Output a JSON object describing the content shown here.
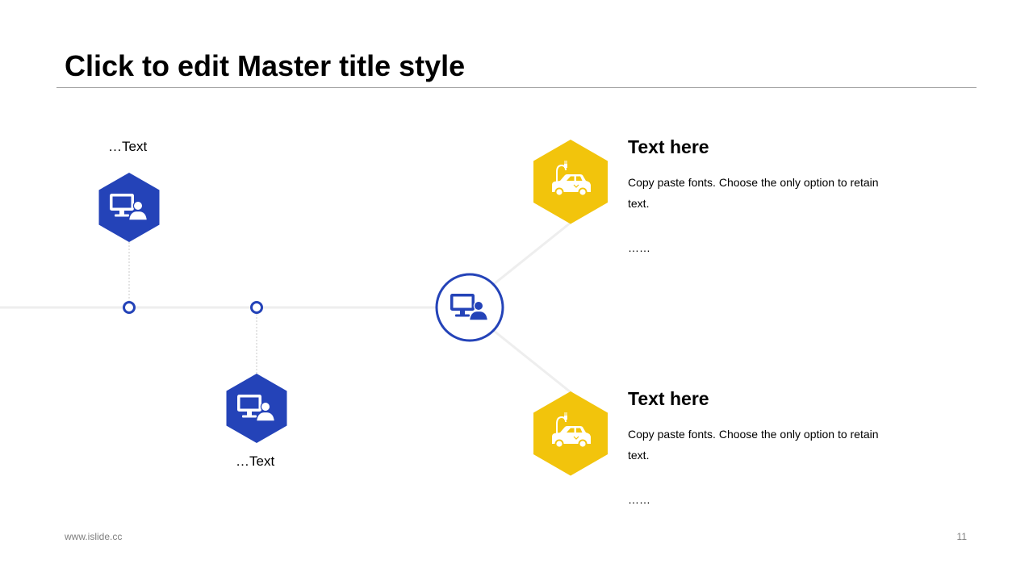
{
  "slide": {
    "title": "Click to edit Master title style",
    "footer_site": "www.islide.cc",
    "page_number": "11"
  },
  "timeline": {
    "upper_label": "…Text",
    "lower_label": "…Text",
    "hub_icon": "computer-user-icon",
    "node_icon": "computer-user-icon"
  },
  "items": [
    {
      "heading": "Text here",
      "body": "Copy paste fonts. Choose the only option to retain text.",
      "more": "……",
      "icon": "electric-car-icon"
    },
    {
      "heading": "Text here",
      "body": "Copy paste fonts. Choose the only option to retain text.",
      "more": "……",
      "icon": "electric-car-icon"
    }
  ],
  "colors": {
    "blue": "#2443b8",
    "yellow": "#f2c40c",
    "connector": "#eeeeee",
    "dashed_line": "#c8c8c8"
  }
}
